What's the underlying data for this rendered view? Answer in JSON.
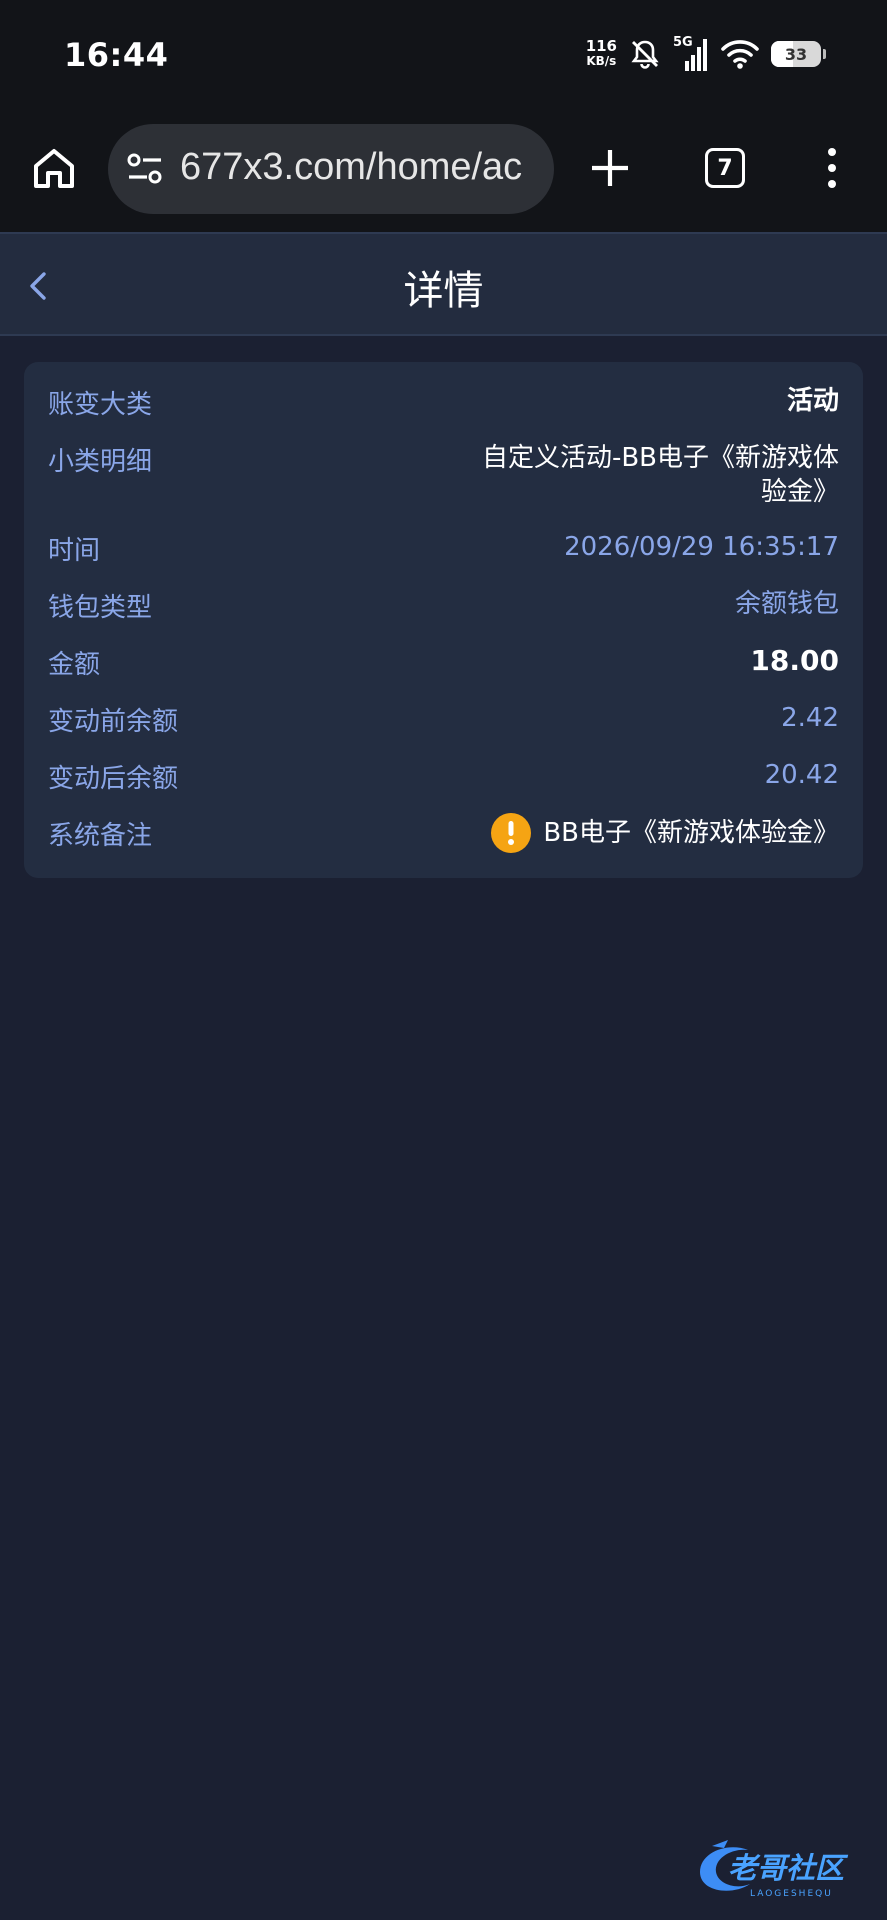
{
  "status_bar": {
    "time": "16:44",
    "net_speed_value": "116",
    "net_speed_unit": "KB/s",
    "network_type": "5G",
    "battery_level": "33",
    "icons": [
      "bell-off-icon",
      "signal-icon",
      "wifi-icon",
      "battery-icon"
    ]
  },
  "browser": {
    "url": "677x3.com/home/ac",
    "tab_count": "7",
    "icons": [
      "home-icon",
      "site-settings-icon",
      "plus-icon",
      "tabs-icon",
      "more-vert-icon"
    ]
  },
  "header": {
    "title": "详情",
    "back_icon": "chevron-left-icon"
  },
  "detail": {
    "category": {
      "label": "账变大类",
      "value": "活动"
    },
    "subcategory": {
      "label": "小类明细",
      "value_line1": "自定义活动-BB电子《新游戏体",
      "value_line2": "验金》"
    },
    "time": {
      "label": "时间",
      "value": "2026/09/29 16:35:17"
    },
    "wallet_type": {
      "label": "钱包类型",
      "value": "余额钱包"
    },
    "amount": {
      "label": "金额",
      "value": "18.00"
    },
    "balance_before": {
      "label": "变动前余额",
      "value": "2.42"
    },
    "balance_after": {
      "label": "变动后余额",
      "value": "20.42"
    },
    "remark": {
      "label": "系统备注",
      "value": "BB电子《新游戏体验金》",
      "icon": "warning-icon"
    }
  },
  "colors": {
    "background": "#1b2032",
    "card": "#232d41",
    "label_blue": "#8aa6e8",
    "warning": "#f5a413"
  },
  "watermark": {
    "text": "老哥社区",
    "subtext": "LAOGESHEQU"
  }
}
